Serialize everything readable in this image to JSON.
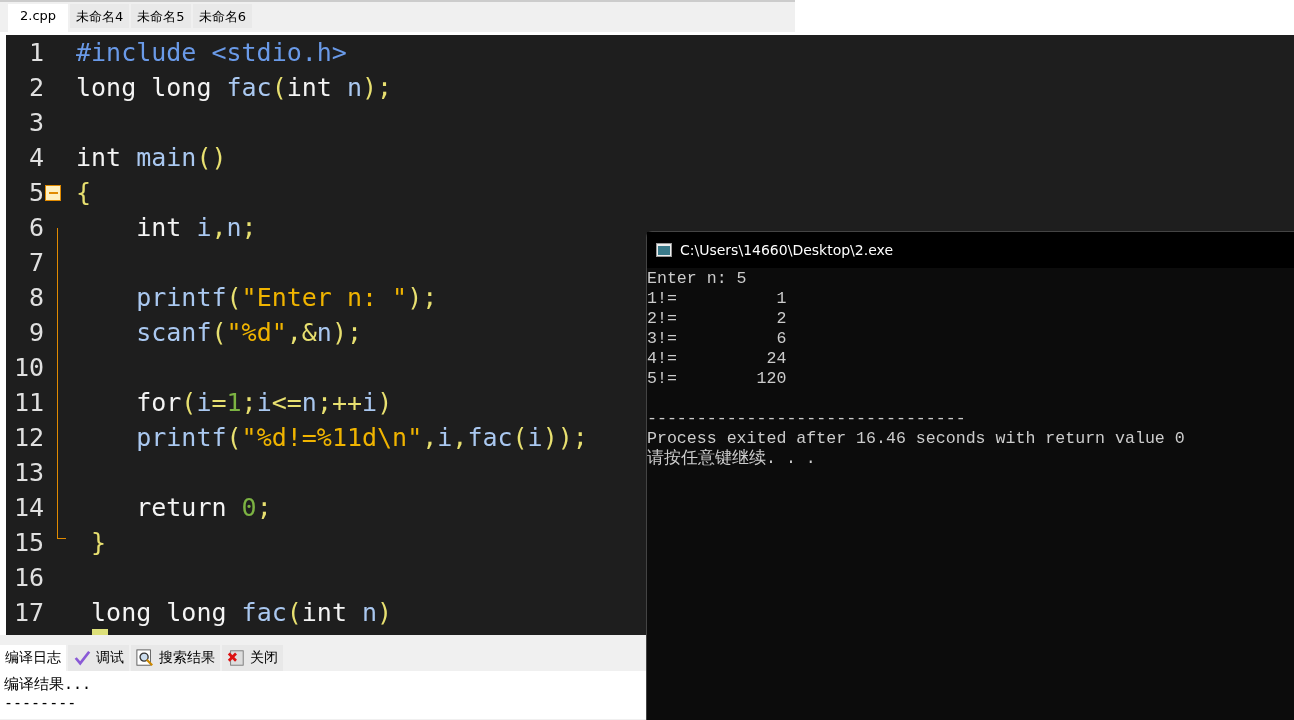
{
  "file_tabs": [
    {
      "label": "2.cpp",
      "selected": true
    },
    {
      "label": "未命名4",
      "selected": false
    },
    {
      "label": "未命名5",
      "selected": false
    },
    {
      "label": "未命名6",
      "selected": false
    }
  ],
  "editor": {
    "lines": [
      {
        "number": "1",
        "tokens": [
          {
            "kind": "pre",
            "text": "#include <stdio.h>"
          }
        ]
      },
      {
        "number": "2",
        "tokens": [
          {
            "kind": "kw",
            "text": "long long "
          },
          {
            "kind": "fn",
            "text": "fac"
          },
          {
            "kind": "punct",
            "text": "("
          },
          {
            "kind": "kw",
            "text": "int "
          },
          {
            "kind": "fn",
            "text": "n"
          },
          {
            "kind": "punct",
            "text": ");"
          }
        ]
      },
      {
        "number": "3"
      },
      {
        "number": "4",
        "tokens": [
          {
            "kind": "kw",
            "text": "int "
          },
          {
            "kind": "fn",
            "text": "main"
          },
          {
            "kind": "punct",
            "text": "()"
          }
        ]
      },
      {
        "number": "5",
        "tokens": [
          {
            "kind": "punct",
            "text": "{"
          }
        ]
      },
      {
        "number": "6",
        "tokens": [
          {
            "kind": "kw",
            "text": "    int "
          },
          {
            "kind": "fn",
            "text": "i"
          },
          {
            "kind": "punct",
            "text": ","
          },
          {
            "kind": "fn",
            "text": "n"
          },
          {
            "kind": "punct",
            "text": ";"
          }
        ]
      },
      {
        "number": "7"
      },
      {
        "number": "8",
        "tokens": [
          {
            "kind": "fn",
            "text": "    printf"
          },
          {
            "kind": "punct",
            "text": "("
          },
          {
            "kind": "str",
            "text": "\"Enter n: \""
          },
          {
            "kind": "punct",
            "text": ");"
          }
        ]
      },
      {
        "number": "9",
        "tokens": [
          {
            "kind": "fn",
            "text": "    scanf"
          },
          {
            "kind": "punct",
            "text": "("
          },
          {
            "kind": "str",
            "text": "\"%d\""
          },
          {
            "kind": "punct",
            "text": ",&"
          },
          {
            "kind": "fn",
            "text": "n"
          },
          {
            "kind": "punct",
            "text": ");"
          }
        ]
      },
      {
        "number": "10"
      },
      {
        "number": "11",
        "tokens": [
          {
            "kind": "kw",
            "text": "    for"
          },
          {
            "kind": "punct",
            "text": "("
          },
          {
            "kind": "fn",
            "text": "i"
          },
          {
            "kind": "punct",
            "text": "="
          },
          {
            "kind": "num",
            "text": "1"
          },
          {
            "kind": "punct",
            "text": ";"
          },
          {
            "kind": "fn",
            "text": "i"
          },
          {
            "kind": "punct",
            "text": "<="
          },
          {
            "kind": "fn",
            "text": "n"
          },
          {
            "kind": "punct",
            "text": ";++"
          },
          {
            "kind": "fn",
            "text": "i"
          },
          {
            "kind": "punct",
            "text": ")"
          }
        ]
      },
      {
        "number": "12",
        "tokens": [
          {
            "kind": "fn",
            "text": "    printf"
          },
          {
            "kind": "punct",
            "text": "("
          },
          {
            "kind": "str",
            "text": "\"%d!=%11d\\n\""
          },
          {
            "kind": "punct",
            "text": ","
          },
          {
            "kind": "fn",
            "text": "i"
          },
          {
            "kind": "punct",
            "text": ","
          },
          {
            "kind": "fn",
            "text": "fac"
          },
          {
            "kind": "punct",
            "text": "("
          },
          {
            "kind": "fn",
            "text": "i"
          },
          {
            "kind": "punct",
            "text": "));"
          }
        ]
      },
      {
        "number": "13"
      },
      {
        "number": "14",
        "tokens": [
          {
            "kind": "kw",
            "text": "    return "
          },
          {
            "kind": "num",
            "text": "0"
          },
          {
            "kind": "punct",
            "text": ";"
          }
        ]
      },
      {
        "number": "15",
        "tokens": [
          {
            "kind": "punct",
            "text": " }"
          }
        ]
      },
      {
        "number": "16"
      },
      {
        "number": "17",
        "tokens": [
          {
            "kind": "kw",
            "text": " long long "
          },
          {
            "kind": "fn",
            "text": "fac"
          },
          {
            "kind": "punct",
            "text": "("
          },
          {
            "kind": "kw",
            "text": "int "
          },
          {
            "kind": "fn",
            "text": "n"
          },
          {
            "kind": "punct",
            "text": ")"
          }
        ]
      }
    ]
  },
  "bottom_tabs": [
    {
      "label": "编译日志",
      "selected": true
    },
    {
      "label": "调试",
      "selected": false
    },
    {
      "label": "搜索结果",
      "selected": false
    },
    {
      "label": "关闭",
      "selected": false
    }
  ],
  "compile_log": [
    "编译结果...",
    "--------"
  ],
  "console": {
    "title": "C:\\Users\\14660\\Desktop\\2.exe",
    "output_lines": [
      "Enter n: 5",
      "1!=          1",
      "2!=          2",
      "3!=          6",
      "4!=         24",
      "5!=        120"
    ],
    "separator": "--------------------------------",
    "footer_lines": [
      "Process exited after 16.46 seconds with return value 0",
      "请按任意键继续. . ."
    ]
  }
}
